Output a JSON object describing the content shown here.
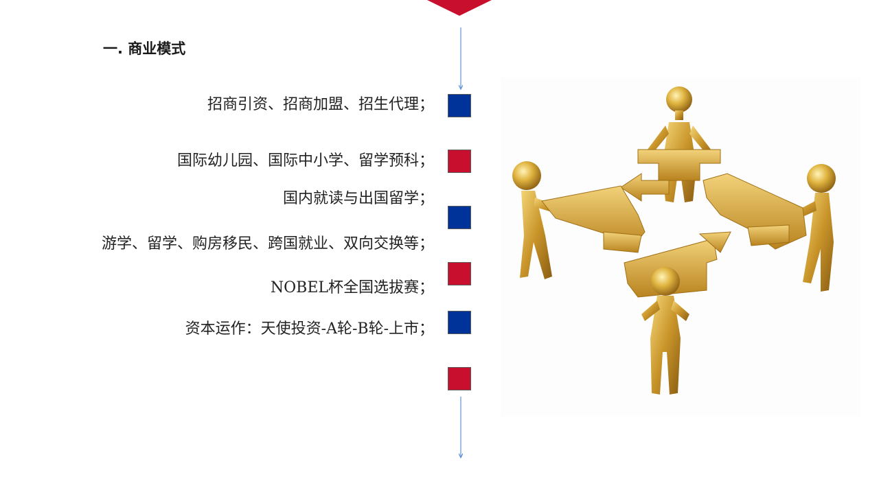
{
  "heading": "一.  商业模式",
  "items": [
    {
      "text": "招商引资、招商加盟、招生代理；"
    },
    {
      "text": "国际幼儿园、国际中小学、留学预科；"
    },
    {
      "text": "国内就读与出国留学；"
    },
    {
      "text": "游学、留学、购房移民、跨国就业、双向交换等；"
    },
    {
      "text": "NOBEL杯全国选拔赛；"
    },
    {
      "text": "资本运作：天使投资-A轮-B轮-上市；"
    }
  ],
  "markers": [
    {
      "color": "#003399"
    },
    {
      "color": "#c8102e"
    },
    {
      "color": "#003399"
    },
    {
      "color": "#c8102e"
    },
    {
      "color": "#003399"
    },
    {
      "color": "#c8102e"
    }
  ],
  "colors": {
    "accent_red": "#c8102e",
    "accent_blue": "#003399",
    "connector_blue": "#5b8fd6",
    "gold": "#d4a93a"
  },
  "illustration": {
    "icon": "golden-figures-arrows-teamwork-icon"
  }
}
